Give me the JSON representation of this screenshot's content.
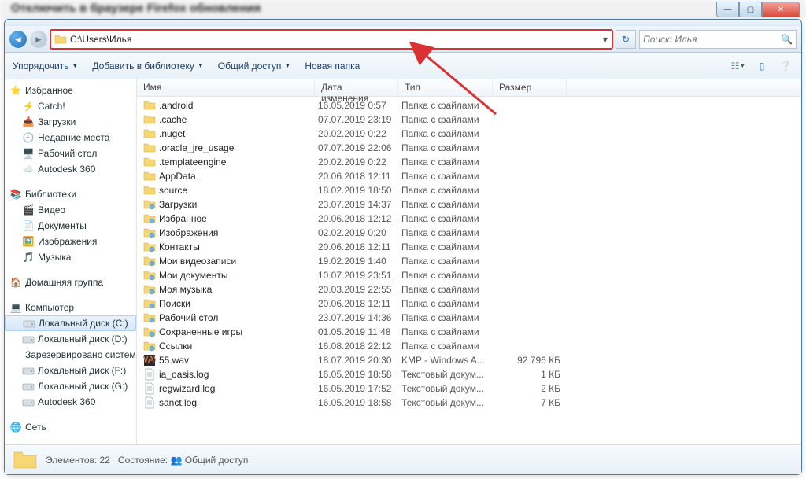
{
  "address_path": "C:\\Users\\Илья",
  "search_placeholder": "Поиск: Илья",
  "toolbar": {
    "organize": "Упорядочить",
    "addlib": "Добавить в библиотеку",
    "share": "Общий доступ",
    "newfolder": "Новая папка"
  },
  "columns": {
    "name": "Имя",
    "date": "Дата изменения",
    "type": "Тип",
    "size": "Размер"
  },
  "sidebar": {
    "fav_head": "Избранное",
    "favs": [
      "Catch!",
      "Загрузки",
      "Недавние места",
      "Рабочий стол",
      "Autodesk 360"
    ],
    "lib_head": "Библиотеки",
    "libs": [
      "Видео",
      "Документы",
      "Изображения",
      "Музыка"
    ],
    "home_head": "Домашняя группа",
    "comp_head": "Компьютер",
    "drives": [
      "Локальный диск (C:)",
      "Локальный диск (D:)",
      "Зарезервировано системой",
      "Локальный диск (F:)",
      "Локальный диск (G:)",
      "Autodesk 360"
    ],
    "net_head": "Сеть"
  },
  "files": [
    {
      "icon": "folder",
      "name": ".android",
      "date": "16.05.2019 0:57",
      "type": "Папка с файлами",
      "size": ""
    },
    {
      "icon": "folder",
      "name": ".cache",
      "date": "07.07.2019 23:19",
      "type": "Папка с файлами",
      "size": ""
    },
    {
      "icon": "folder",
      "name": ".nuget",
      "date": "20.02.2019 0:22",
      "type": "Папка с файлами",
      "size": ""
    },
    {
      "icon": "folder",
      "name": ".oracle_jre_usage",
      "date": "07.07.2019 22:06",
      "type": "Папка с файлами",
      "size": ""
    },
    {
      "icon": "folder",
      "name": ".templateengine",
      "date": "20.02.2019 0:22",
      "type": "Папка с файлами",
      "size": ""
    },
    {
      "icon": "folder",
      "name": "AppData",
      "date": "20.06.2018 12:11",
      "type": "Папка с файлами",
      "size": ""
    },
    {
      "icon": "folder",
      "name": "source",
      "date": "18.02.2019 18:50",
      "type": "Папка с файлами",
      "size": ""
    },
    {
      "icon": "folder-sys",
      "name": "Загрузки",
      "date": "23.07.2019 14:37",
      "type": "Папка с файлами",
      "size": ""
    },
    {
      "icon": "folder-sys",
      "name": "Избранное",
      "date": "20.06.2018 12:12",
      "type": "Папка с файлами",
      "size": ""
    },
    {
      "icon": "folder-sys",
      "name": "Изображения",
      "date": "02.02.2019 0:20",
      "type": "Папка с файлами",
      "size": ""
    },
    {
      "icon": "folder-sys",
      "name": "Контакты",
      "date": "20.06.2018 12:11",
      "type": "Папка с файлами",
      "size": ""
    },
    {
      "icon": "folder-sys",
      "name": "Мои видеозаписи",
      "date": "19.02.2019 1:40",
      "type": "Папка с файлами",
      "size": ""
    },
    {
      "icon": "folder-sys",
      "name": "Мои документы",
      "date": "10.07.2019 23:51",
      "type": "Папка с файлами",
      "size": ""
    },
    {
      "icon": "folder-sys",
      "name": "Моя музыка",
      "date": "20.03.2019 22:55",
      "type": "Папка с файлами",
      "size": ""
    },
    {
      "icon": "folder-sys",
      "name": "Поиски",
      "date": "20.06.2018 12:11",
      "type": "Папка с файлами",
      "size": ""
    },
    {
      "icon": "folder-sys",
      "name": "Рабочий стол",
      "date": "23.07.2019 14:36",
      "type": "Папка с файлами",
      "size": ""
    },
    {
      "icon": "folder-sys",
      "name": "Сохраненные игры",
      "date": "01.05.2019 11:48",
      "type": "Папка с файлами",
      "size": ""
    },
    {
      "icon": "folder-sys",
      "name": "Ссылки",
      "date": "16.08.2018 22:12",
      "type": "Папка с файлами",
      "size": ""
    },
    {
      "icon": "wav",
      "name": "55.wav",
      "date": "18.07.2019 20:30",
      "type": "KMP - Windows A...",
      "size": "92 796 КБ"
    },
    {
      "icon": "txt",
      "name": "ia_oasis.log",
      "date": "16.05.2019 18:58",
      "type": "Текстовый докум...",
      "size": "1 КБ"
    },
    {
      "icon": "txt",
      "name": "regwizard.log",
      "date": "16.05.2019 17:52",
      "type": "Текстовый докум...",
      "size": "2 КБ"
    },
    {
      "icon": "txt",
      "name": "sanct.log",
      "date": "16.05.2019 18:58",
      "type": "Текстовый докум...",
      "size": "7 КБ"
    }
  ],
  "status": {
    "elements_label": "Элементов:",
    "elements_count": "22",
    "state_label": "Состояние:",
    "state_value": "Общий доступ"
  }
}
